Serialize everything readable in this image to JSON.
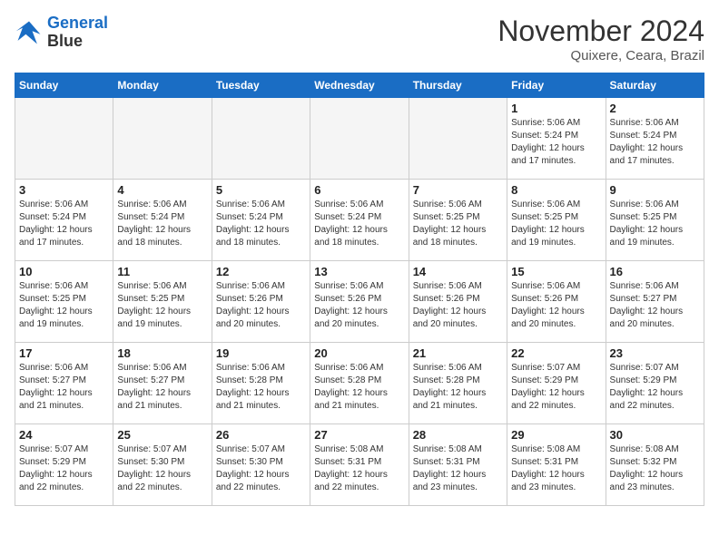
{
  "logo": {
    "line1": "General",
    "line2": "Blue"
  },
  "title": "November 2024",
  "subtitle": "Quixere, Ceara, Brazil",
  "weekdays": [
    "Sunday",
    "Monday",
    "Tuesday",
    "Wednesday",
    "Thursday",
    "Friday",
    "Saturday"
  ],
  "weeks": [
    [
      {
        "day": "",
        "empty": true
      },
      {
        "day": "",
        "empty": true
      },
      {
        "day": "",
        "empty": true
      },
      {
        "day": "",
        "empty": true
      },
      {
        "day": "",
        "empty": true
      },
      {
        "day": "1",
        "sunrise": "5:06 AM",
        "sunset": "5:24 PM",
        "daylight": "12 hours and 17 minutes."
      },
      {
        "day": "2",
        "sunrise": "5:06 AM",
        "sunset": "5:24 PM",
        "daylight": "12 hours and 17 minutes."
      }
    ],
    [
      {
        "day": "3",
        "sunrise": "5:06 AM",
        "sunset": "5:24 PM",
        "daylight": "12 hours and 17 minutes."
      },
      {
        "day": "4",
        "sunrise": "5:06 AM",
        "sunset": "5:24 PM",
        "daylight": "12 hours and 18 minutes."
      },
      {
        "day": "5",
        "sunrise": "5:06 AM",
        "sunset": "5:24 PM",
        "daylight": "12 hours and 18 minutes."
      },
      {
        "day": "6",
        "sunrise": "5:06 AM",
        "sunset": "5:24 PM",
        "daylight": "12 hours and 18 minutes."
      },
      {
        "day": "7",
        "sunrise": "5:06 AM",
        "sunset": "5:25 PM",
        "daylight": "12 hours and 18 minutes."
      },
      {
        "day": "8",
        "sunrise": "5:06 AM",
        "sunset": "5:25 PM",
        "daylight": "12 hours and 19 minutes."
      },
      {
        "day": "9",
        "sunrise": "5:06 AM",
        "sunset": "5:25 PM",
        "daylight": "12 hours and 19 minutes."
      }
    ],
    [
      {
        "day": "10",
        "sunrise": "5:06 AM",
        "sunset": "5:25 PM",
        "daylight": "12 hours and 19 minutes."
      },
      {
        "day": "11",
        "sunrise": "5:06 AM",
        "sunset": "5:25 PM",
        "daylight": "12 hours and 19 minutes."
      },
      {
        "day": "12",
        "sunrise": "5:06 AM",
        "sunset": "5:26 PM",
        "daylight": "12 hours and 20 minutes."
      },
      {
        "day": "13",
        "sunrise": "5:06 AM",
        "sunset": "5:26 PM",
        "daylight": "12 hours and 20 minutes."
      },
      {
        "day": "14",
        "sunrise": "5:06 AM",
        "sunset": "5:26 PM",
        "daylight": "12 hours and 20 minutes."
      },
      {
        "day": "15",
        "sunrise": "5:06 AM",
        "sunset": "5:26 PM",
        "daylight": "12 hours and 20 minutes."
      },
      {
        "day": "16",
        "sunrise": "5:06 AM",
        "sunset": "5:27 PM",
        "daylight": "12 hours and 20 minutes."
      }
    ],
    [
      {
        "day": "17",
        "sunrise": "5:06 AM",
        "sunset": "5:27 PM",
        "daylight": "12 hours and 21 minutes."
      },
      {
        "day": "18",
        "sunrise": "5:06 AM",
        "sunset": "5:27 PM",
        "daylight": "12 hours and 21 minutes."
      },
      {
        "day": "19",
        "sunrise": "5:06 AM",
        "sunset": "5:28 PM",
        "daylight": "12 hours and 21 minutes."
      },
      {
        "day": "20",
        "sunrise": "5:06 AM",
        "sunset": "5:28 PM",
        "daylight": "12 hours and 21 minutes."
      },
      {
        "day": "21",
        "sunrise": "5:06 AM",
        "sunset": "5:28 PM",
        "daylight": "12 hours and 21 minutes."
      },
      {
        "day": "22",
        "sunrise": "5:07 AM",
        "sunset": "5:29 PM",
        "daylight": "12 hours and 22 minutes."
      },
      {
        "day": "23",
        "sunrise": "5:07 AM",
        "sunset": "5:29 PM",
        "daylight": "12 hours and 22 minutes."
      }
    ],
    [
      {
        "day": "24",
        "sunrise": "5:07 AM",
        "sunset": "5:29 PM",
        "daylight": "12 hours and 22 minutes."
      },
      {
        "day": "25",
        "sunrise": "5:07 AM",
        "sunset": "5:30 PM",
        "daylight": "12 hours and 22 minutes."
      },
      {
        "day": "26",
        "sunrise": "5:07 AM",
        "sunset": "5:30 PM",
        "daylight": "12 hours and 22 minutes."
      },
      {
        "day": "27",
        "sunrise": "5:08 AM",
        "sunset": "5:31 PM",
        "daylight": "12 hours and 22 minutes."
      },
      {
        "day": "28",
        "sunrise": "5:08 AM",
        "sunset": "5:31 PM",
        "daylight": "12 hours and 23 minutes."
      },
      {
        "day": "29",
        "sunrise": "5:08 AM",
        "sunset": "5:31 PM",
        "daylight": "12 hours and 23 minutes."
      },
      {
        "day": "30",
        "sunrise": "5:08 AM",
        "sunset": "5:32 PM",
        "daylight": "12 hours and 23 minutes."
      }
    ]
  ]
}
